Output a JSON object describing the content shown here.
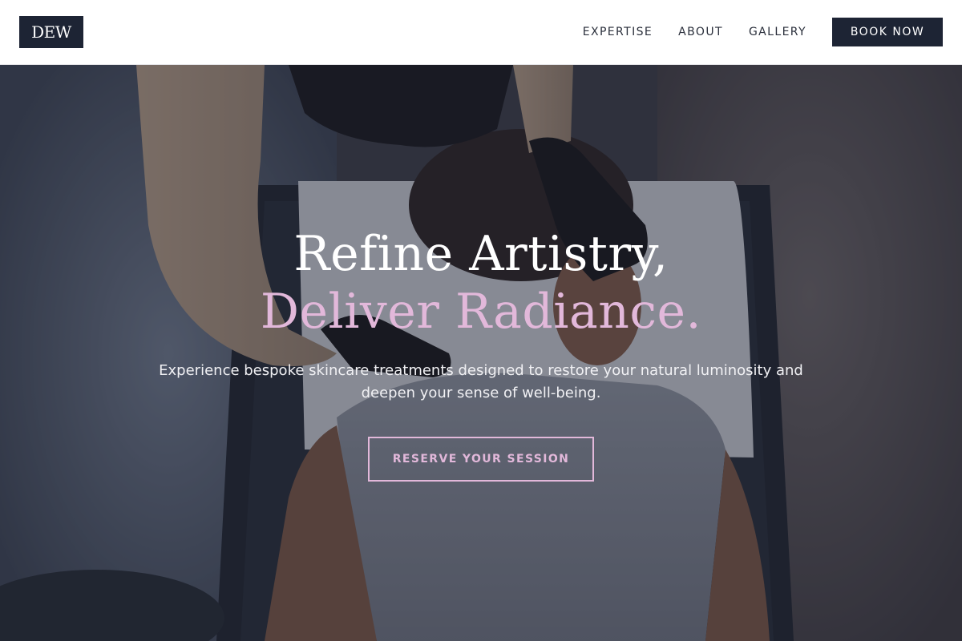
{
  "header": {
    "logo_text": "DEW",
    "nav": [
      {
        "label": "EXPERTISE"
      },
      {
        "label": "ABOUT"
      },
      {
        "label": "GALLERY"
      }
    ],
    "cta_label": "BOOK NOW"
  },
  "hero": {
    "headline_line1": "Refine Artistry,",
    "headline_line2": "Deliver Radiance.",
    "subtext": "Experience bespoke skincare treatments designed to restore your natural luminosity and deepen your sense of well-being.",
    "cta_label": "RESERVE YOUR SESSION"
  },
  "colors": {
    "navy": "#1d2434",
    "accent_pink": "#e2b8da",
    "white": "#ffffff"
  }
}
